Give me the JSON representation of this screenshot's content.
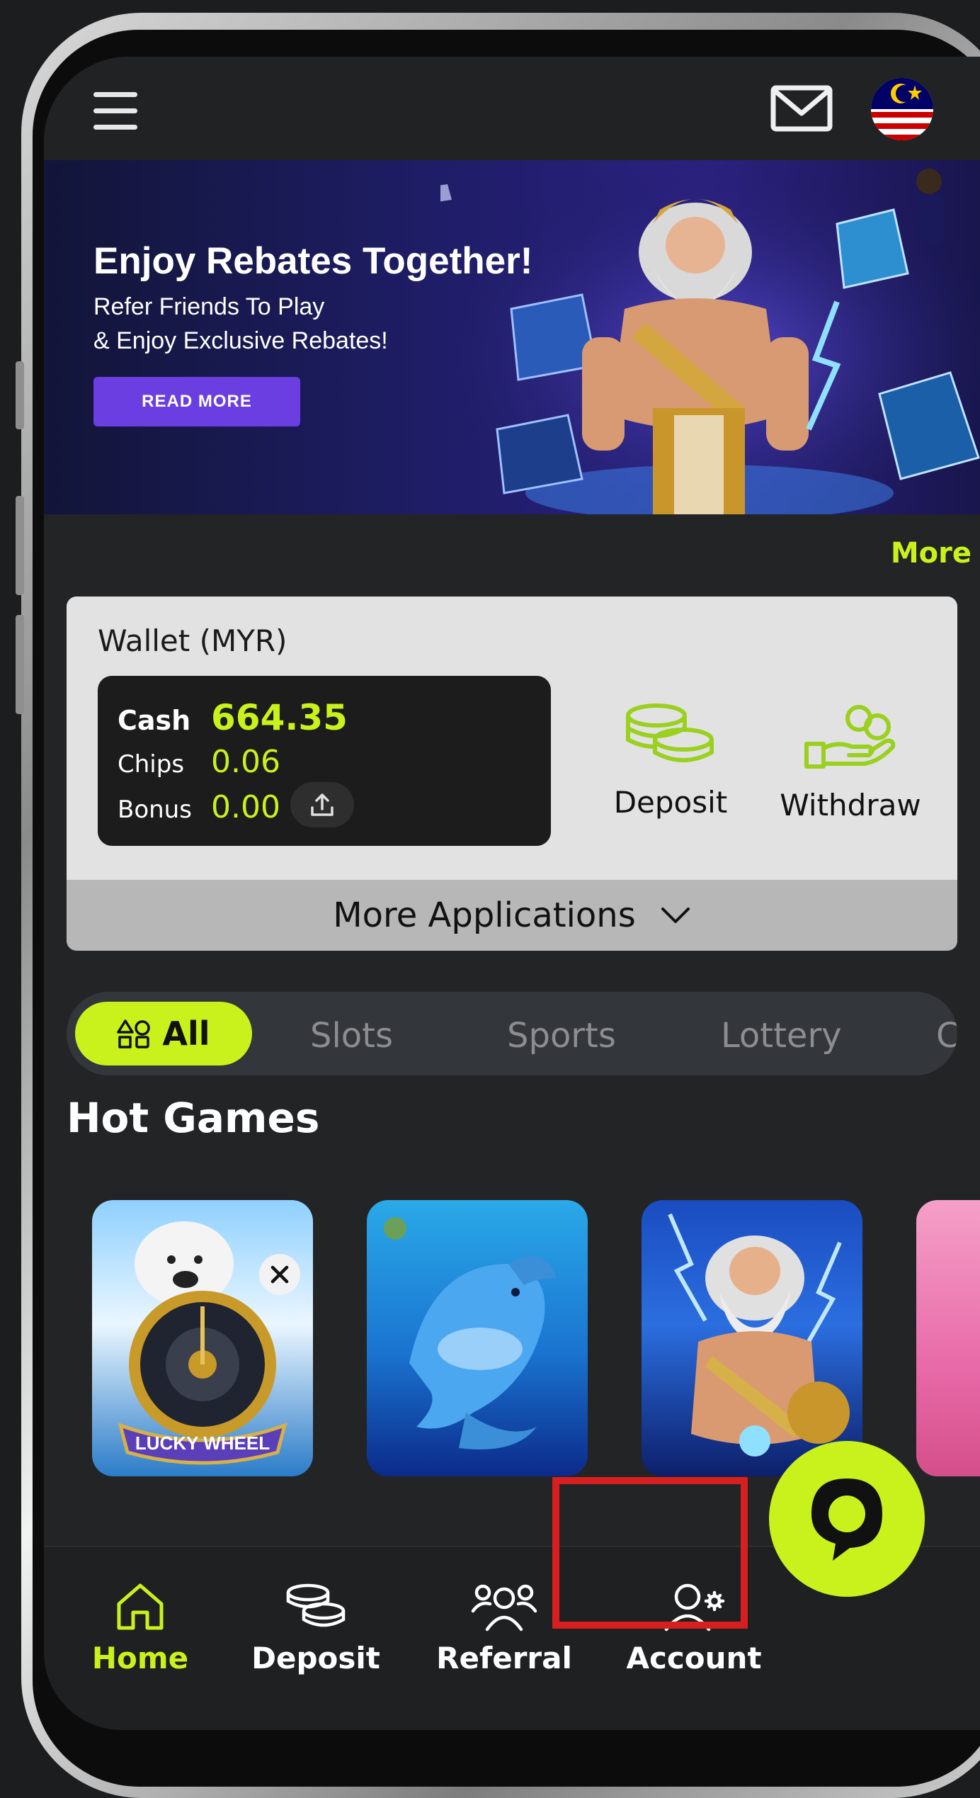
{
  "banner": {
    "title": "Enjoy Rebates Together!",
    "subtitle_line1": "Refer Friends To Play",
    "subtitle_line2": "& Enjoy Exclusive Rebates!",
    "button_label": "READ MORE"
  },
  "more_link": "More",
  "wallet": {
    "title": "Wallet (MYR)",
    "cash_label": "Cash",
    "cash_value": "664.35",
    "chips_label": "Chips",
    "chips_value": "0.06",
    "bonus_label": "Bonus",
    "bonus_value": "0.00",
    "deposit_label": "Deposit",
    "withdraw_label": "Withdraw",
    "more_apps_label": "More Applications"
  },
  "categories": {
    "active_label": "All",
    "items": [
      "Slots",
      "Sports",
      "Lottery",
      "Co"
    ]
  },
  "hot_games": {
    "title": "Hot Games",
    "games": [
      {
        "label": "LUCKY WHEEL"
      }
    ]
  },
  "bottom_nav": {
    "items": [
      {
        "label": "Home",
        "icon": "home-icon",
        "active": true
      },
      {
        "label": "Deposit",
        "icon": "coins-icon",
        "active": false
      },
      {
        "label": "Referral",
        "icon": "referral-icon",
        "active": false
      },
      {
        "label": "Account",
        "icon": "account-icon",
        "active": false
      }
    ]
  },
  "colors": {
    "accent": "#c9f21c",
    "highlight_border": "#d71f1f",
    "banner_button": "#6a3ee0"
  }
}
